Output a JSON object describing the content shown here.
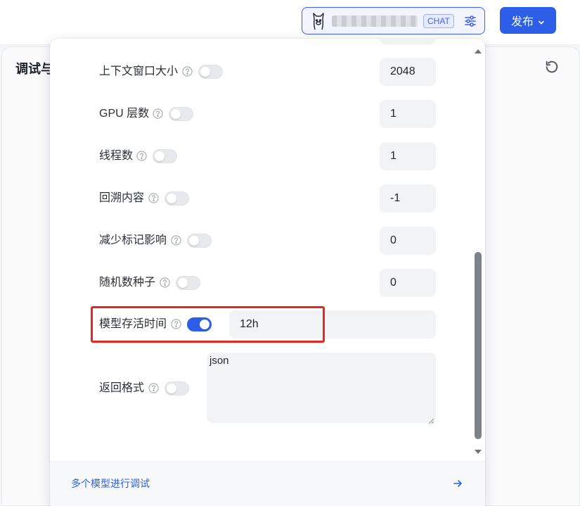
{
  "page": {
    "title": "调试与",
    "publish_label": "发布"
  },
  "model_selector": {
    "name": "llama3",
    "tag": "CHAT"
  },
  "params": [
    {
      "label": "上下文窗口大小",
      "enabled": false,
      "value": "2048"
    },
    {
      "label": "GPU 层数",
      "enabled": false,
      "value": "1"
    },
    {
      "label": "线程数",
      "enabled": false,
      "value": "1"
    },
    {
      "label": "回溯内容",
      "enabled": false,
      "value": "-1"
    },
    {
      "label": "减少标记影响",
      "enabled": false,
      "value": "0"
    },
    {
      "label": "随机数种子",
      "enabled": false,
      "value": "0"
    },
    {
      "label": "模型存活时间",
      "enabled": true,
      "value": "12h"
    },
    {
      "label": "返回格式",
      "enabled": false,
      "value": "json"
    }
  ],
  "footer": {
    "multi_model_label": "多个模型进行调试"
  },
  "colors": {
    "accent": "#2c5ee8",
    "highlight": "#e5281f"
  }
}
